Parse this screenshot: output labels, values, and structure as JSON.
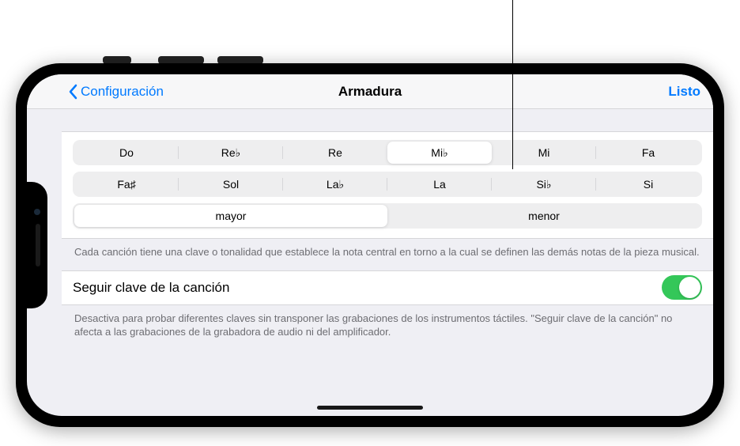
{
  "nav": {
    "back_label": "Configuración",
    "title": "Armadura",
    "done_label": "Listo"
  },
  "keys_row1": [
    {
      "label": "Do",
      "selected": false
    },
    {
      "label": "Re♭",
      "selected": false
    },
    {
      "label": "Re",
      "selected": false
    },
    {
      "label": "Mi♭",
      "selected": true
    },
    {
      "label": "Mi",
      "selected": false
    },
    {
      "label": "Fa",
      "selected": false
    }
  ],
  "keys_row2": [
    {
      "label": "Fa♯",
      "selected": false
    },
    {
      "label": "Sol",
      "selected": false
    },
    {
      "label": "La♭",
      "selected": false
    },
    {
      "label": "La",
      "selected": false
    },
    {
      "label": "Si♭",
      "selected": false
    },
    {
      "label": "Si",
      "selected": false
    }
  ],
  "scales": [
    {
      "label": "mayor",
      "selected": true
    },
    {
      "label": "menor",
      "selected": false
    }
  ],
  "key_description": "Cada canción tiene una clave o tonalidad que establece la nota central en torno a la cual se definen las demás notas de la pieza musical.",
  "follow_key": {
    "label": "Seguir clave de la canción",
    "value": true,
    "description": "Desactiva para probar diferentes claves sin transponer las grabaciones de los instrumentos táctiles. \"Seguir clave de la canción\" no afecta a las grabaciones de la grabadora de audio ni del amplificador."
  },
  "colors": {
    "tint": "#007aff",
    "toggle_on": "#34c759"
  }
}
